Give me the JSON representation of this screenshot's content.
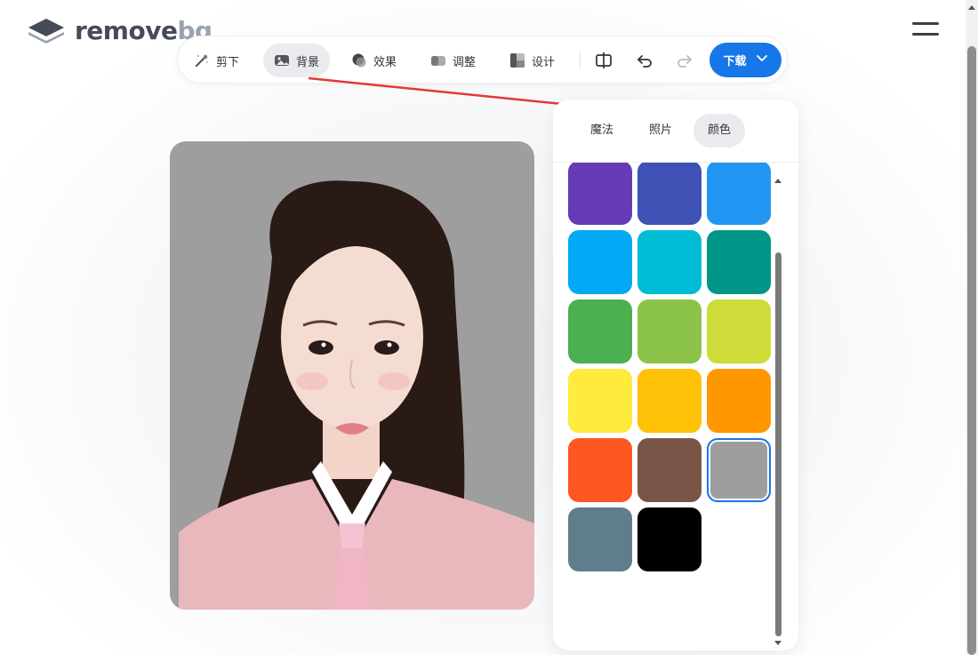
{
  "app": {
    "logo_main": "remove",
    "logo_accent": "bg"
  },
  "toolbar": {
    "tools": [
      {
        "label": "剪下",
        "icon": "magic-brush-icon"
      },
      {
        "label": "背景",
        "icon": "image-icon",
        "active": true
      },
      {
        "label": "效果",
        "icon": "effect-icon"
      },
      {
        "label": "调整",
        "icon": "adjust-icon"
      },
      {
        "label": "设计",
        "icon": "design-icon"
      }
    ],
    "compare_icon": "compare-icon",
    "undo_icon": "undo-icon",
    "redo_icon": "redo-icon",
    "download_label": "下载"
  },
  "panel": {
    "tabs": [
      {
        "label": "魔法"
      },
      {
        "label": "照片"
      },
      {
        "label": "颜色",
        "active": true
      }
    ],
    "swatches": [
      "#f44336",
      "#e91e63",
      "#9c27b0",
      "#673ab7",
      "#3f51b5",
      "#2196f3",
      "#03a9f4",
      "#00bcd4",
      "#009688",
      "#4caf50",
      "#8bc34a",
      "#cddc39",
      "#ffeb3b",
      "#ffc107",
      "#ff9800",
      "#ff5722",
      "#795548",
      "#9e9e9e",
      "#607d8b",
      "#000000"
    ],
    "selected_color": "#9e9e9e"
  },
  "colors": {
    "accent": "#1677e8",
    "annotation_arrow": "#e53935",
    "photo_background": "#9e9e9e"
  }
}
